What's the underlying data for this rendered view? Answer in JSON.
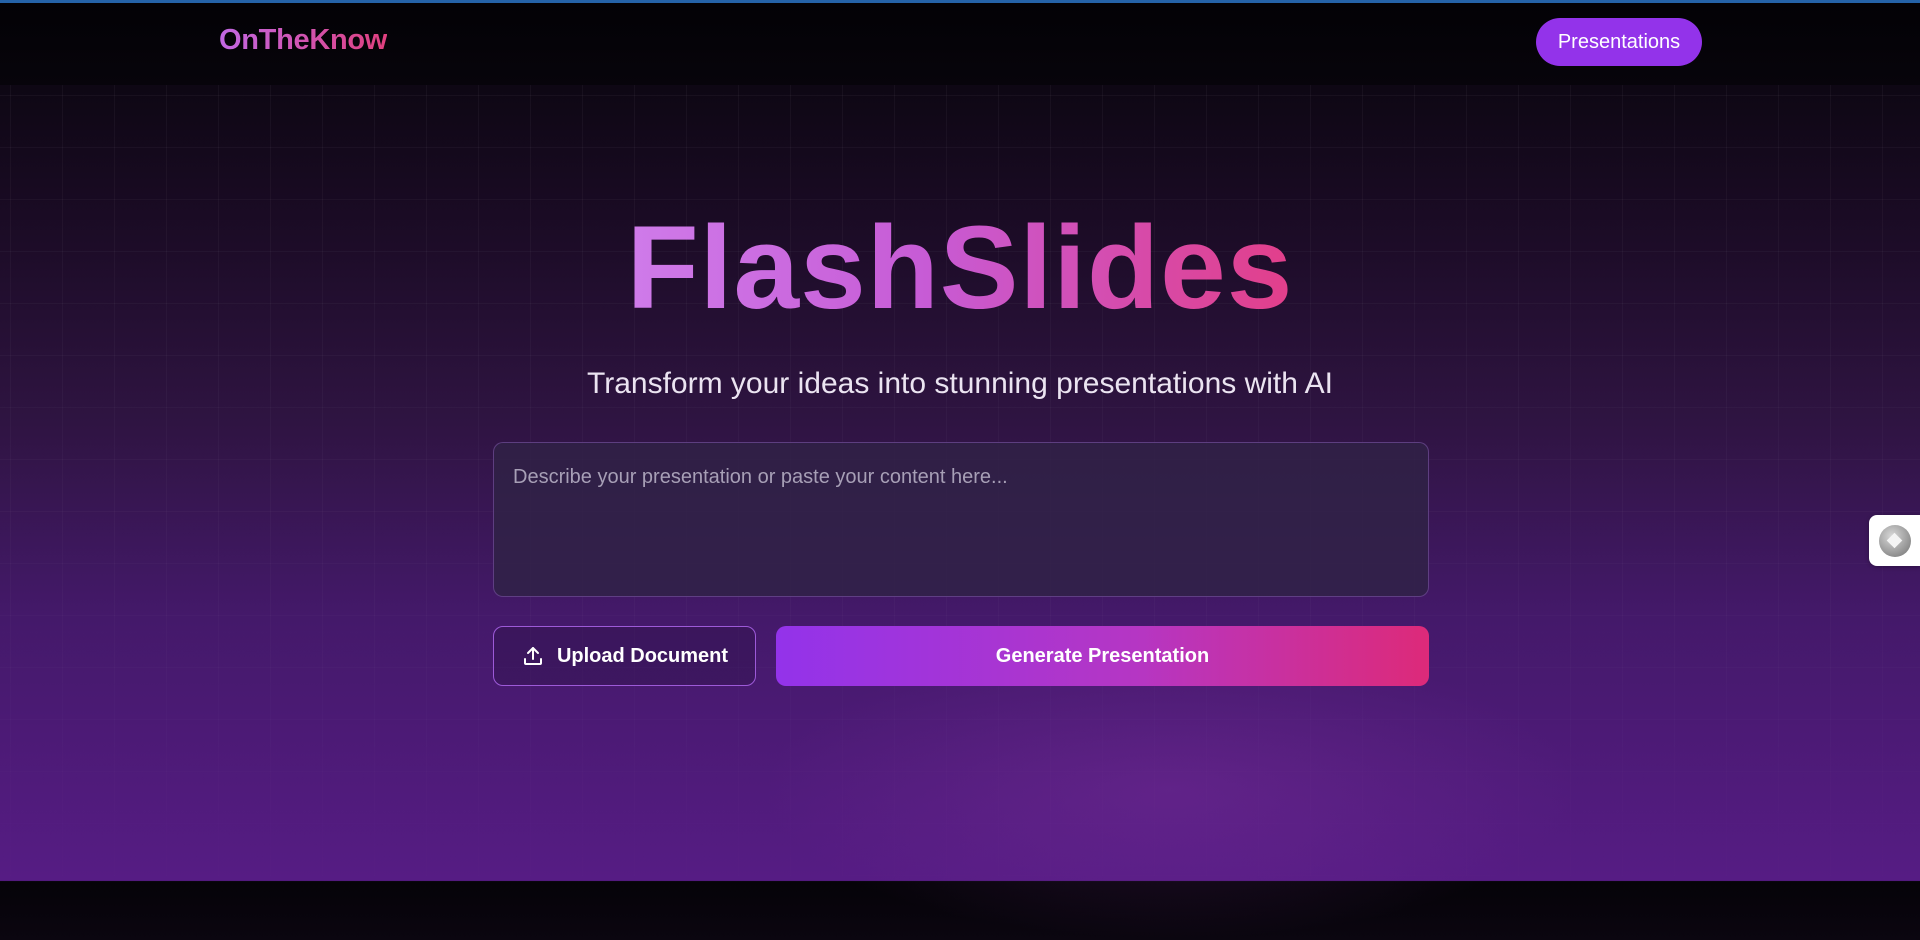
{
  "header": {
    "brand": "OnTheKnow",
    "nav_button_label": "Presentations"
  },
  "hero": {
    "title": "FlashSlides",
    "subtitle": "Transform your ideas into stunning presentations with AI"
  },
  "prompt": {
    "value": "",
    "placeholder": "Describe your presentation or paste your content here..."
  },
  "actions": {
    "upload_label": "Upload Document",
    "upload_icon": "upload-icon",
    "generate_label": "Generate Presentation"
  },
  "side_widget": {
    "icon": "extension-icon"
  },
  "colors": {
    "accent": "#9333ea",
    "gradient_end": "#dd2a79",
    "top_line": "#2563a8"
  }
}
